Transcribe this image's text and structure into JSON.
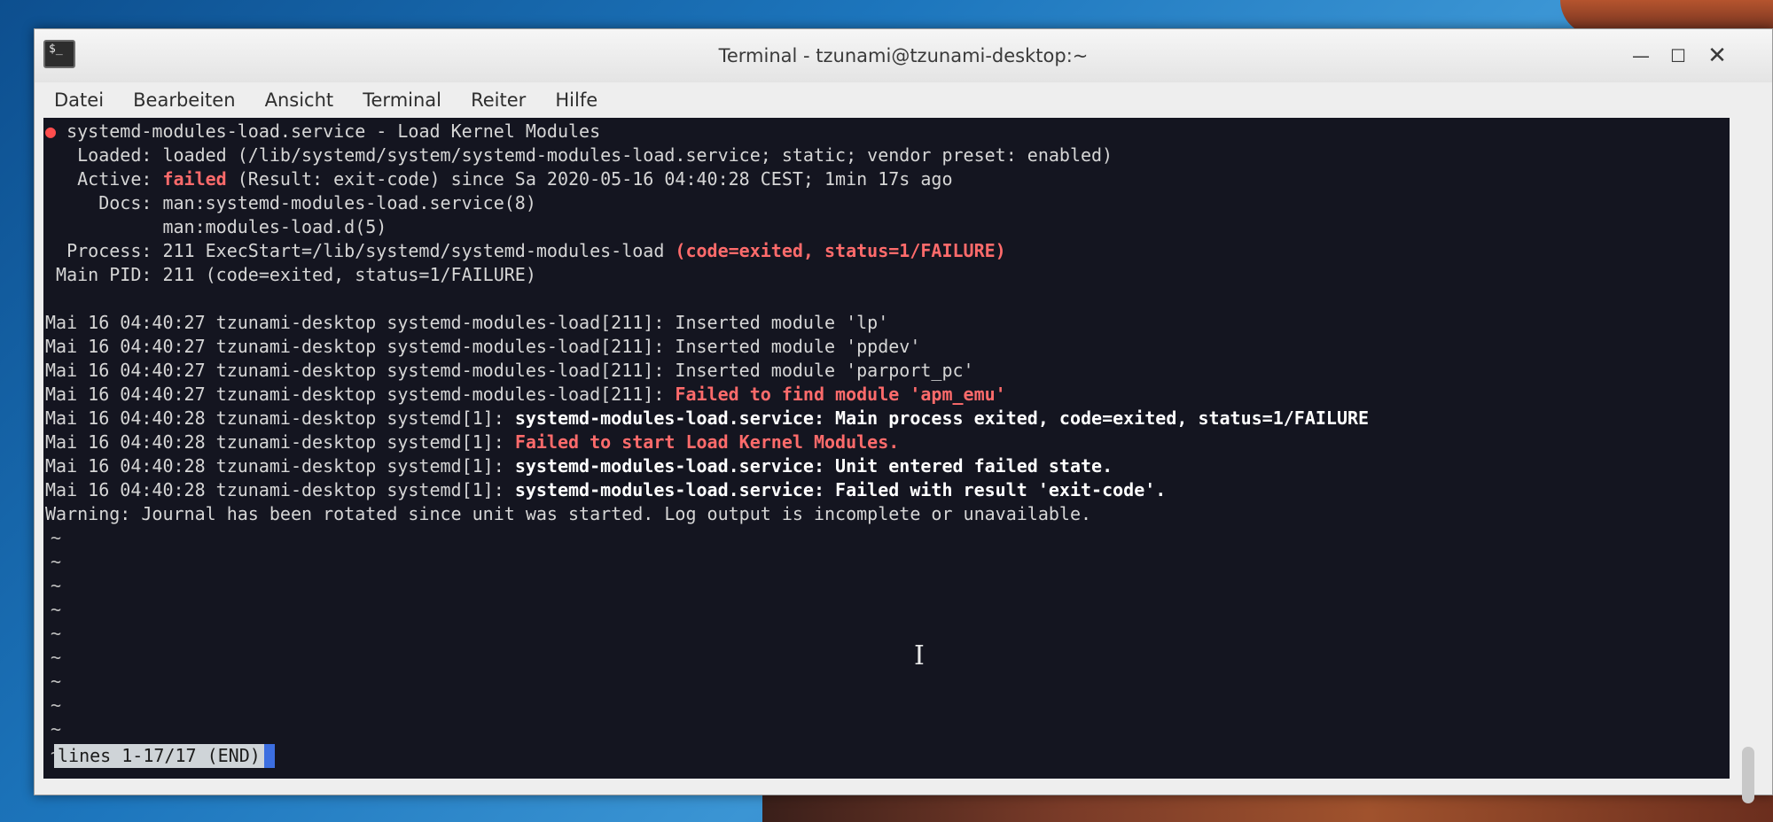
{
  "window": {
    "title": "Terminal - tzunami@tzunami-desktop:~",
    "app_icon_text": "$_",
    "controls": {
      "minimize": "—",
      "maximize": "☐",
      "close": "✕"
    }
  },
  "menu": [
    "Datei",
    "Bearbeiten",
    "Ansicht",
    "Terminal",
    "Reiter",
    "Hilfe"
  ],
  "terminal": {
    "lines": [
      {
        "t": [
          {
            "c": "dot",
            "s": "●"
          },
          {
            "s": " systemd-modules-load.service - Load Kernel Modules"
          }
        ]
      },
      {
        "t": [
          {
            "s": "   Loaded: loaded (/lib/systemd/system/systemd-modules-load.service; static; vendor preset: enabled)"
          }
        ]
      },
      {
        "t": [
          {
            "s": "   Active: "
          },
          {
            "c": "r",
            "s": "failed"
          },
          {
            "s": " (Result: exit-code) since Sa 2020-05-16 04:40:28 CEST; 1min 17s ago"
          }
        ]
      },
      {
        "t": [
          {
            "s": "     Docs: man:systemd-modules-load.service(8)"
          }
        ]
      },
      {
        "t": [
          {
            "s": "           man:modules-load.d(5)"
          }
        ]
      },
      {
        "t": [
          {
            "s": "  Process: 211 ExecStart=/lib/systemd/systemd-modules-load "
          },
          {
            "c": "r",
            "s": "(code=exited, status=1/FAILURE)"
          }
        ]
      },
      {
        "t": [
          {
            "s": " Main PID: 211 (code=exited, status=1/FAILURE)"
          }
        ]
      },
      {
        "t": [
          {
            "s": ""
          }
        ]
      },
      {
        "t": [
          {
            "s": "Mai 16 04:40:27 tzunami-desktop systemd-modules-load[211]: Inserted module 'lp'"
          }
        ]
      },
      {
        "t": [
          {
            "s": "Mai 16 04:40:27 tzunami-desktop systemd-modules-load[211]: Inserted module 'ppdev'"
          }
        ]
      },
      {
        "t": [
          {
            "s": "Mai 16 04:40:27 tzunami-desktop systemd-modules-load[211]: Inserted module 'parport_pc'"
          }
        ]
      },
      {
        "t": [
          {
            "s": "Mai 16 04:40:27 tzunami-desktop systemd-modules-load[211]: "
          },
          {
            "c": "r",
            "s": "Failed to find module 'apm_emu'"
          }
        ]
      },
      {
        "t": [
          {
            "s": "Mai 16 04:40:28 tzunami-desktop systemd[1]: "
          },
          {
            "c": "w",
            "s": "systemd-modules-load.service: Main process exited, code=exited, status=1/FAILURE"
          }
        ]
      },
      {
        "t": [
          {
            "s": "Mai 16 04:40:28 tzunami-desktop systemd[1]: "
          },
          {
            "c": "r",
            "s": "Failed to start Load Kernel Modules."
          }
        ]
      },
      {
        "t": [
          {
            "s": "Mai 16 04:40:28 tzunami-desktop systemd[1]: "
          },
          {
            "c": "w",
            "s": "systemd-modules-load.service: Unit entered failed state."
          }
        ]
      },
      {
        "t": [
          {
            "s": "Mai 16 04:40:28 tzunami-desktop systemd[1]: "
          },
          {
            "c": "w",
            "s": "systemd-modules-load.service: Failed with result 'exit-code'."
          }
        ]
      },
      {
        "t": [
          {
            "s": "Warning: Journal has been rotated since unit was started. Log output is incomplete or unavailable."
          }
        ]
      }
    ],
    "tilde_lines": [
      "~",
      "~",
      "~",
      "~",
      "~",
      "~",
      "~",
      "~",
      "~",
      "~"
    ],
    "status": "lines 1-17/17 (END)"
  },
  "colors": {
    "terminal_bg": "#141520",
    "error_red": "#ff6b6b",
    "cursor_blue": "#3c6ee0"
  }
}
